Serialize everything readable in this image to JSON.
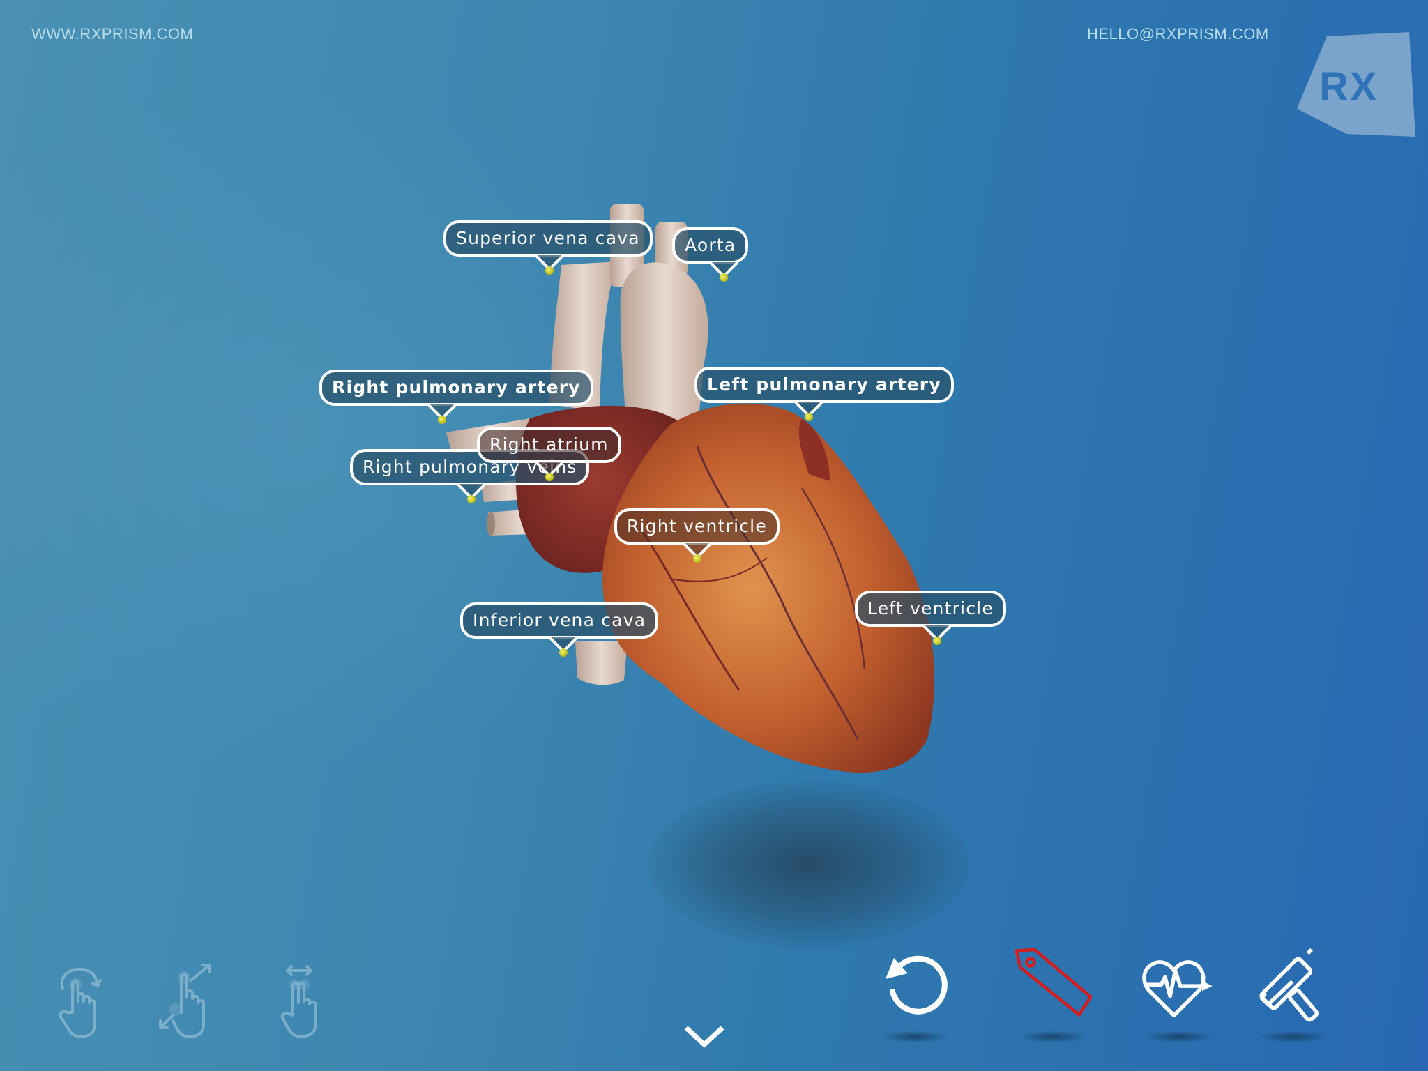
{
  "header": {
    "website": "WWW.RXPRISM.COM",
    "email": "HELLO@RXPRISM.COM",
    "logo_text": "RX"
  },
  "model": {
    "subject": "Human heart",
    "labels": [
      {
        "id": "superior-vena-cava",
        "text": "Superior vena cava"
      },
      {
        "id": "aorta",
        "text": "Aorta"
      },
      {
        "id": "right-pulmonary-artery",
        "text": "Right pulmonary artery"
      },
      {
        "id": "left-pulmonary-artery",
        "text": "Left pulmonary artery"
      },
      {
        "id": "right-pulmonary-veins",
        "text": "Right pulmonary veins"
      },
      {
        "id": "right-atrium",
        "text": "Right atrium"
      },
      {
        "id": "right-ventricle",
        "text": "Right ventricle"
      },
      {
        "id": "inferior-vena-cava",
        "text": "Inferior vena cava"
      },
      {
        "id": "left-ventricle",
        "text": "Left ventricle"
      }
    ]
  },
  "gestures": [
    {
      "icon": "rotate-gesture-icon",
      "hint": "one-finger rotate"
    },
    {
      "icon": "pinch-zoom-gesture-icon",
      "hint": "pinch to zoom"
    },
    {
      "icon": "two-finger-pan-gesture-icon",
      "hint": "two-finger pan"
    }
  ],
  "toolbar": {
    "items": [
      {
        "icon": "reset-icon",
        "label": "Reset view",
        "active": false
      },
      {
        "icon": "label-tag-icon",
        "label": "Labels",
        "active": true
      },
      {
        "icon": "heartbeat-icon",
        "label": "Animation",
        "active": false
      },
      {
        "icon": "paint-roller-icon",
        "label": "Paint",
        "active": false
      }
    ],
    "active_color": "#d21e1e",
    "inactive_color": "#ffffff"
  },
  "collapse": {
    "icon": "chevron-down-icon"
  }
}
